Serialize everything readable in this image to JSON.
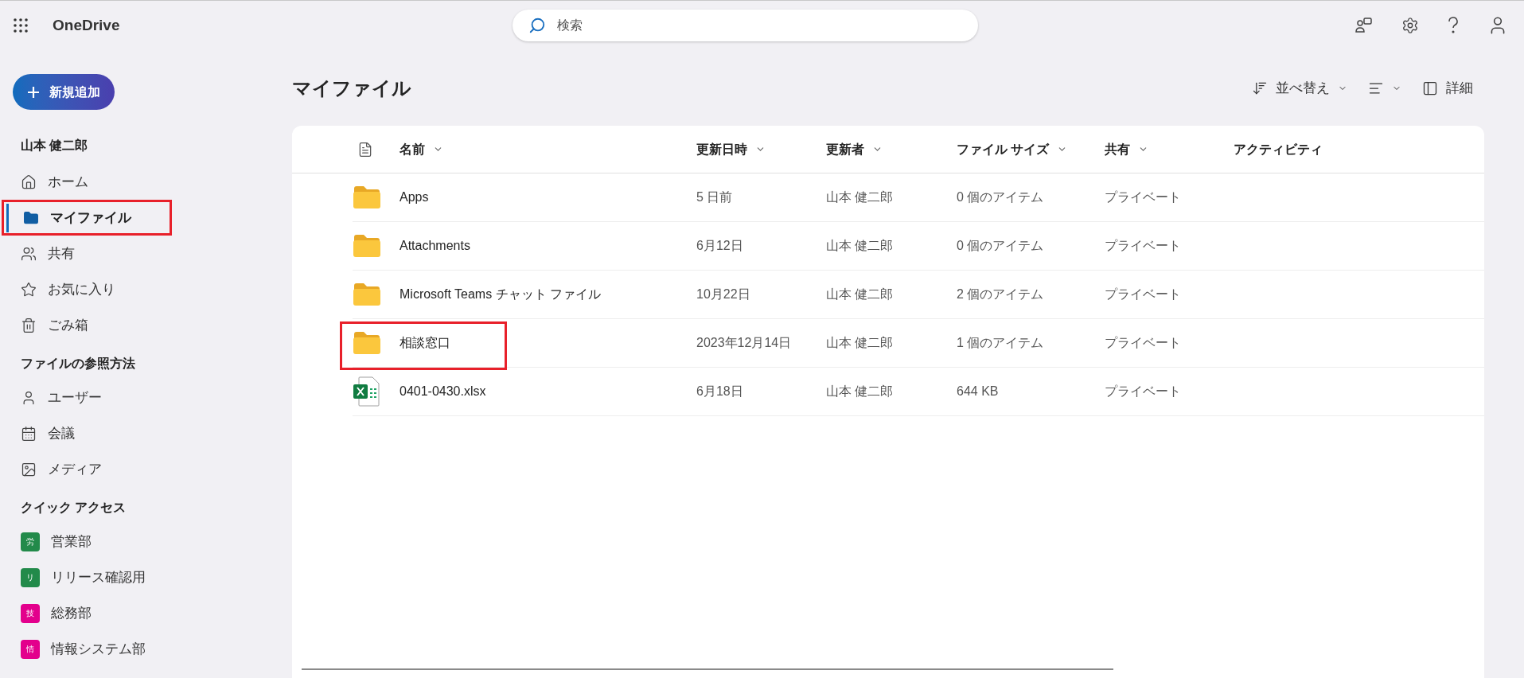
{
  "app": {
    "name": "OneDrive"
  },
  "search": {
    "placeholder": "検索"
  },
  "new_button": {
    "label": "新規追加"
  },
  "sidebar": {
    "user": "山本 健二郎",
    "items": [
      {
        "label": "ホーム",
        "selected": false,
        "highlighted": false
      },
      {
        "label": "マイファイル",
        "selected": true,
        "highlighted": true
      },
      {
        "label": "共有",
        "selected": false,
        "highlighted": false
      },
      {
        "label": "お気に入り",
        "selected": false,
        "highlighted": false
      },
      {
        "label": "ごみ箱",
        "selected": false,
        "highlighted": false
      }
    ],
    "browse_heading": "ファイルの参照方法",
    "browse_items": [
      {
        "label": "ユーザー"
      },
      {
        "label": "会議"
      },
      {
        "label": "メディア"
      }
    ],
    "quick_heading": "クイック アクセス",
    "quick_items": [
      {
        "label": "営業部",
        "badge": "労",
        "color": "#228a4a"
      },
      {
        "label": "リリース確認用",
        "badge": "リ",
        "color": "#228a4a"
      },
      {
        "label": "総務部",
        "badge": "技",
        "color": "#e3008c"
      },
      {
        "label": "情報システム部",
        "badge": "情",
        "color": "#e3008c"
      }
    ]
  },
  "page_title": "マイファイル",
  "toolbar": {
    "sort": "並べ替え",
    "details": "詳細"
  },
  "table": {
    "columns": [
      {
        "label": "名前",
        "sortable": true
      },
      {
        "label": "更新日時",
        "sortable": true
      },
      {
        "label": "更新者",
        "sortable": true
      },
      {
        "label": "ファイル サイズ",
        "sortable": true
      },
      {
        "label": "共有",
        "sortable": true
      },
      {
        "label": "アクティビティ",
        "sortable": false
      }
    ],
    "rows": [
      {
        "kind": "folder",
        "name": "Apps",
        "modified": "5 日前",
        "modified_by": "山本 健二郎",
        "size": "0 個のアイテム",
        "sharing": "プライベート",
        "highlighted": false
      },
      {
        "kind": "folder",
        "name": "Attachments",
        "modified": "6月12日",
        "modified_by": "山本 健二郎",
        "size": "0 個のアイテム",
        "sharing": "プライベート",
        "highlighted": false
      },
      {
        "kind": "folder",
        "name": "Microsoft Teams チャット ファイル",
        "modified": "10月22日",
        "modified_by": "山本 健二郎",
        "size": "2 個のアイテム",
        "sharing": "プライベート",
        "highlighted": false
      },
      {
        "kind": "folder",
        "name": "相談窓口",
        "modified": "2023年12月14日",
        "modified_by": "山本 健二郎",
        "size": "1 個のアイテム",
        "sharing": "プライベート",
        "highlighted": true
      },
      {
        "kind": "excel",
        "name": "0401-0430.xlsx",
        "modified": "6月18日",
        "modified_by": "山本 健二郎",
        "size": "644 KB",
        "sharing": "プライベート",
        "highlighted": false
      }
    ]
  }
}
